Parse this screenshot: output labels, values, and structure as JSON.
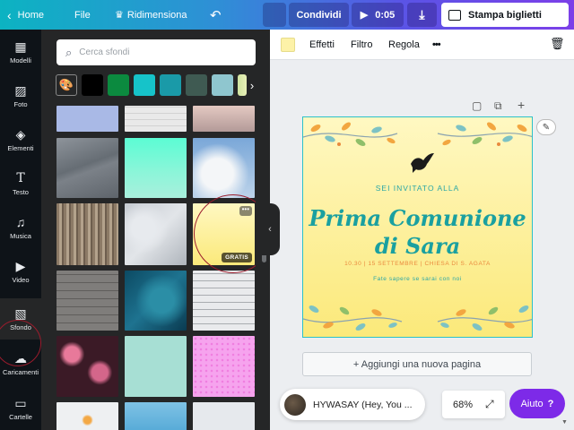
{
  "topbar": {
    "back_label": "Home",
    "file_label": "File",
    "resize_label": "Ridimensiona",
    "share_label": "Condividi",
    "play_time": "0:05",
    "print_label": "Stampa biglietti",
    "colors": {
      "gradient_start": "#0cb3c2",
      "gradient_end": "#7c3fe8"
    }
  },
  "rail": {
    "items": [
      {
        "label": "Modelli",
        "icon": "layout-icon"
      },
      {
        "label": "Foto",
        "icon": "image-icon"
      },
      {
        "label": "Elementi",
        "icon": "shapes-icon"
      },
      {
        "label": "Testo",
        "icon": "text-icon"
      },
      {
        "label": "Musica",
        "icon": "music-icon"
      },
      {
        "label": "Video",
        "icon": "video-icon"
      },
      {
        "label": "Sfondo",
        "icon": "background-icon",
        "active": true
      },
      {
        "label": "Caricamenti",
        "icon": "upload-icon"
      },
      {
        "label": "Cartelle",
        "icon": "folder-icon"
      }
    ]
  },
  "panel": {
    "search_placeholder": "Cerca sfondi",
    "swatches": [
      "#000000",
      "#0b8a3f",
      "#16c3c9",
      "#1a9aa8",
      "#3f5a52",
      "#8fc6cf",
      "#d5e6a0"
    ],
    "badge_label": "GRATIS",
    "more_label": "•••"
  },
  "context_toolbar": {
    "selected_color": "#fdf2a8",
    "effects_label": "Effetti",
    "filter_label": "Filtro",
    "adjust_label": "Regola",
    "more_label": "•••"
  },
  "design": {
    "subtitle": "SEI INVITATO ALLA",
    "title_line1": "Prima Comunione",
    "title_line2": "di Sara",
    "date_line": "10.30 | 15 SETTEMBRE | CHIESA DI S. AGATA",
    "rsvp_line": "Fate sapere se sarai con noi",
    "colors": {
      "accent": "#1aa0a0",
      "date": "#e98a3e",
      "background": "#fbe97a"
    }
  },
  "footer": {
    "add_page_label": "+ Aggiungi una nuova pagina",
    "music_title": "HYWASAY (Hey, You ...",
    "zoom_level": "68%",
    "help_label": "Aiuto",
    "help_symbol": "?"
  }
}
